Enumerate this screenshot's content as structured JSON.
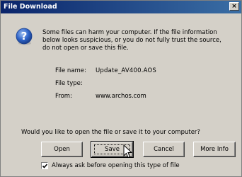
{
  "dialog": {
    "title": "File Download",
    "close_glyph": "×"
  },
  "warning": {
    "icon": "question-icon",
    "text": "Some files can harm your computer. If the file information below looks suspicious, or you do not fully trust the source, do not open or save this file."
  },
  "file_info": {
    "name_label": "File name:",
    "name_value": "Update_AV400.AOS",
    "type_label": "File type:",
    "type_value": "",
    "from_label": "From:",
    "from_value": "www.archos.com"
  },
  "prompt": "Would you like to open the file or save it to your computer?",
  "buttons": {
    "open": "Open",
    "save": "Save",
    "cancel": "Cancel",
    "more_info": "More Info"
  },
  "checkbox": {
    "label": "Always ask before opening this type of file",
    "checked": true
  },
  "colors": {
    "titlebar_start": "#0a246a",
    "titlebar_end": "#3a6ea5",
    "dialog_bg": "#d4d0c8"
  }
}
